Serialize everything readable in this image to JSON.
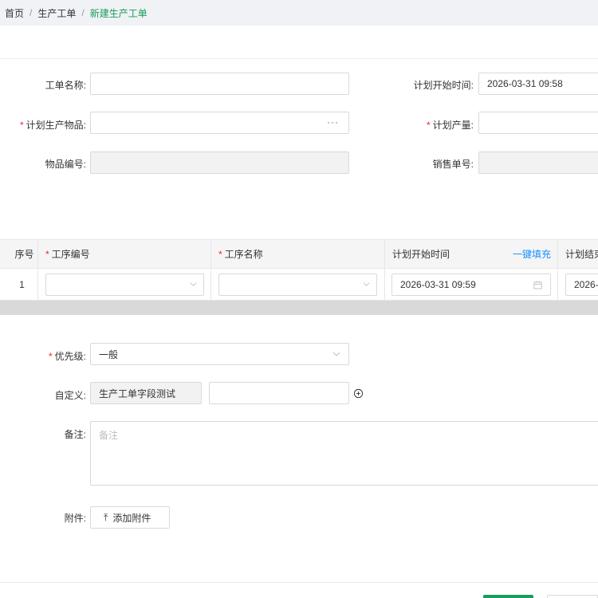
{
  "breadcrumb": {
    "home": "首页",
    "section": "生产工单",
    "current": "新建生产工单",
    "separator": "/"
  },
  "form": {
    "order_name_label": "工单名称:",
    "plan_start_label": "计划开始时间:",
    "plan_start_value": "2026-03-31 09:58",
    "plan_item_label": "计划生产物品:",
    "plan_qty_label": "计划产量:",
    "item_code_label": "物品编号:",
    "sales_no_label": "销售单号:",
    "picker_glyph": "···"
  },
  "table": {
    "headers": {
      "seq": "序号",
      "process_code": "工序编号",
      "process_name": "工序名称",
      "plan_start": "计划开始时间",
      "one_click_fill": "一键填充",
      "plan_end": "计划结束"
    },
    "rows": [
      {
        "seq": "1",
        "plan_start": "2026-03-31 09:59",
        "plan_end": "2026-"
      }
    ]
  },
  "extra": {
    "priority_label": "优先级:",
    "priority_value": "一般",
    "custom_label": "自定义:",
    "custom_field_name": "生产工单字段测试",
    "remark_label": "备注:",
    "remark_placeholder": "备注",
    "attachment_label": "附件:",
    "upload_button": "添加附件",
    "upload_glyph": "⤒"
  },
  "required_mark": "*",
  "colors": {
    "primary": "#1a9c5b",
    "link": "#1890ff",
    "required": "#f5222d"
  }
}
